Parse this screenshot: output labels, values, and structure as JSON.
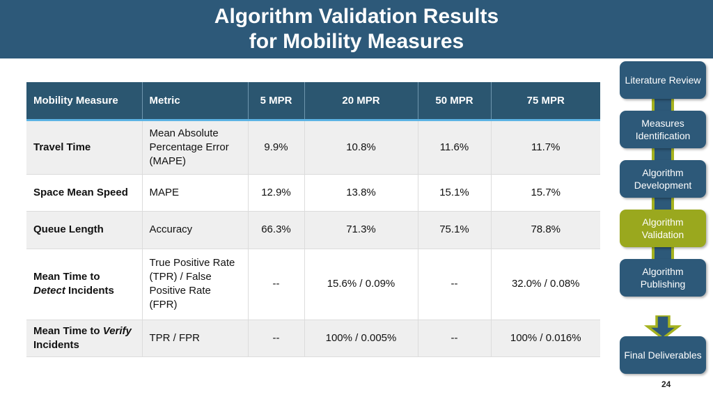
{
  "title": {
    "line1": "Algorithm Validation Results",
    "line2": "for Mobility Measures"
  },
  "colors": {
    "banner_blue": "#2d5979",
    "table_header_blue": "#2b5670",
    "accent_light_blue": "#5cb3e4",
    "highlight_olive": "#9aa81e",
    "connector_olive": "#a5b21f",
    "row_shade": "#efefef"
  },
  "table": {
    "headers": [
      "Mobility Measure",
      "Metric",
      "5 MPR",
      "20 MPR",
      "50 MPR",
      "75 MPR"
    ],
    "rows": [
      {
        "measure": "Travel Time",
        "measure_emphasis": "",
        "measure_tail": "",
        "metric": "Mean Absolute Percentage Error (MAPE)",
        "values": [
          "9.9%",
          "10.8%",
          "11.6%",
          "11.7%"
        ]
      },
      {
        "measure": "Space Mean Speed",
        "measure_emphasis": "",
        "measure_tail": "",
        "metric": "MAPE",
        "values": [
          "12.9%",
          "13.8%",
          "15.1%",
          "15.7%"
        ]
      },
      {
        "measure": "Queue Length",
        "measure_emphasis": "",
        "measure_tail": "",
        "metric": "Accuracy",
        "values": [
          "66.3%",
          "71.3%",
          "75.1%",
          "78.8%"
        ]
      },
      {
        "measure": "Mean Time to ",
        "measure_emphasis": "Detect",
        "measure_tail": " Incidents",
        "metric": "True Positive Rate (TPR) / False Positive Rate (FPR)",
        "values": [
          "--",
          "15.6% / 0.09%",
          "--",
          "32.0% / 0.08%"
        ]
      },
      {
        "measure": "Mean Time to ",
        "measure_emphasis": "Verify",
        "measure_tail": " Incidents",
        "metric": "TPR / FPR",
        "values": [
          "--",
          "100% / 0.005%",
          "--",
          "100% / 0.016%"
        ]
      }
    ]
  },
  "flow": {
    "steps": [
      {
        "label": "Literature Review",
        "current": false
      },
      {
        "label": "Measures Identification",
        "current": false
      },
      {
        "label": "Algorithm Development",
        "current": false
      },
      {
        "label": "Algorithm Validation",
        "current": true
      },
      {
        "label": "Algorithm Publishing",
        "current": false
      },
      {
        "label": "Final Deliverables",
        "current": false
      }
    ]
  },
  "page_number": "24"
}
